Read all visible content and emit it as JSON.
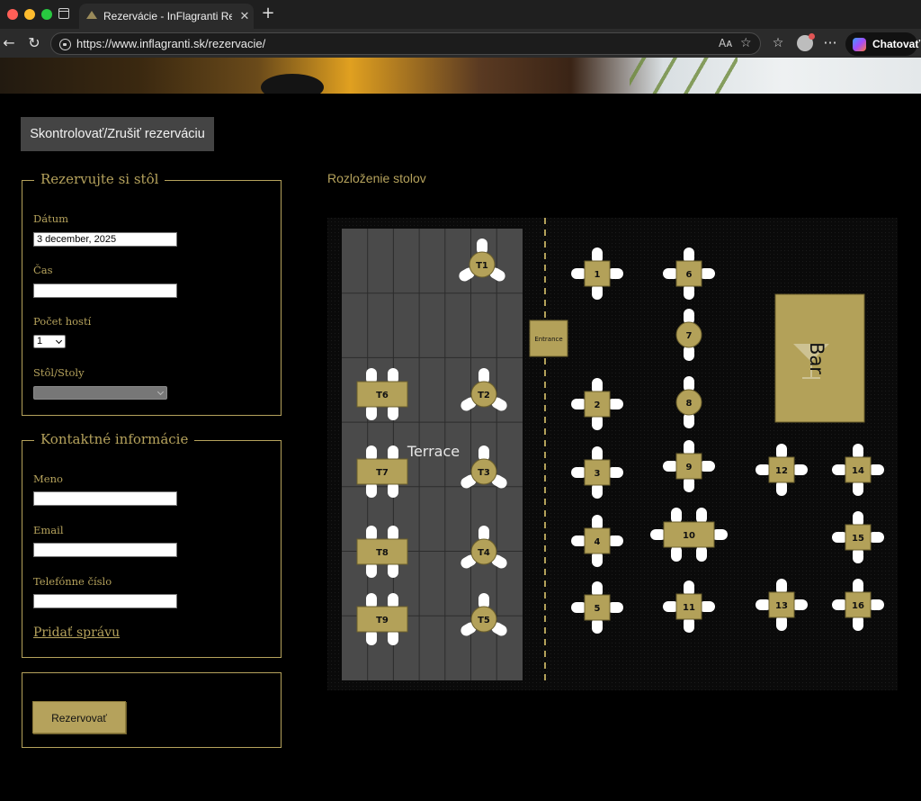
{
  "browser": {
    "tab_title": "Rezervácie - InFlagranti Restau",
    "url": "https://www.inflagranti.sk/rezervacie/",
    "copilot_label": "Chatovať",
    "reader_icon_text": "Aᴀ"
  },
  "page": {
    "check_button": "Skontrolovať/Zrušiť rezerváciu",
    "reserve_section": {
      "legend": "Rezervujte si stôl",
      "date_label": "Dátum",
      "date_value": "3 december, 2025",
      "time_label": "Čas",
      "time_value": "",
      "guests_label": "Počet hostí",
      "guests_value": "1",
      "table_label": "Stôl/Stoly"
    },
    "contact_section": {
      "legend": "Kontaktné informácie",
      "name_label": "Meno",
      "email_label": "Email",
      "phone_label": "Telefónne číslo",
      "add_message": "Pridať správu"
    },
    "reserve_button": "Rezervovať",
    "layout_title": "Rozloženie stolov"
  },
  "floor_plan": {
    "terrace_label": "Terrace",
    "entrance_label": "Entrance",
    "bar_label": "Bar",
    "colors": {
      "table": "#b3a159",
      "terrace": "#4a4a4a",
      "chair": "#ffffff",
      "floor": "#0d0d0d"
    },
    "tables": [
      {
        "id": "T1",
        "type": "round3"
      },
      {
        "id": "T2",
        "type": "round3"
      },
      {
        "id": "T3",
        "type": "round3"
      },
      {
        "id": "T4",
        "type": "round3"
      },
      {
        "id": "T5",
        "type": "round3"
      },
      {
        "id": "T6",
        "type": "rect4"
      },
      {
        "id": "T7",
        "type": "rect4"
      },
      {
        "id": "T8",
        "type": "rect4"
      },
      {
        "id": "T9",
        "type": "rect4"
      },
      {
        "id": "1",
        "type": "square4"
      },
      {
        "id": "2",
        "type": "square4"
      },
      {
        "id": "3",
        "type": "square4"
      },
      {
        "id": "4",
        "type": "square4"
      },
      {
        "id": "5",
        "type": "square4"
      },
      {
        "id": "6",
        "type": "square4"
      },
      {
        "id": "7",
        "type": "round2"
      },
      {
        "id": "8",
        "type": "round2"
      },
      {
        "id": "9",
        "type": "square4"
      },
      {
        "id": "10",
        "type": "long6"
      },
      {
        "id": "11",
        "type": "square4"
      },
      {
        "id": "12",
        "type": "square4"
      },
      {
        "id": "13",
        "type": "square4"
      },
      {
        "id": "14",
        "type": "square4"
      },
      {
        "id": "15",
        "type": "square4"
      },
      {
        "id": "16",
        "type": "square4"
      }
    ]
  }
}
